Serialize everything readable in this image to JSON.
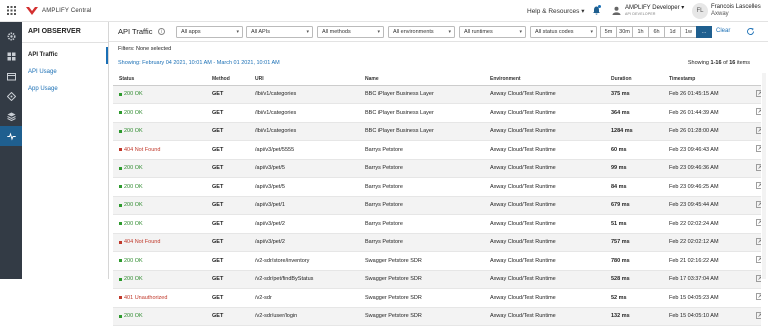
{
  "app": {
    "title": "AMPLIFY Central",
    "help_label": "Help & Resources",
    "user_role_title": "AMPLIFY Developer",
    "user_role_sub": "API DEVELOPER",
    "avatar_initials": "FL",
    "user_name": "Francois Lascelles",
    "user_org": "Axway",
    "brand_color": "#d32f2f",
    "accent_color": "#1f5f8f"
  },
  "left_nav": {
    "icons": [
      "settings-icon",
      "apps-icon",
      "catalog-icon",
      "topology-icon",
      "stack-icon",
      "observer-icon"
    ]
  },
  "sub_nav": {
    "title": "API OBSERVER",
    "items": [
      {
        "label": "API Traffic"
      },
      {
        "label": "API Usage"
      },
      {
        "label": "App Usage"
      }
    ]
  },
  "toolbar": {
    "title": "API Traffic",
    "apps_dropdown": "All apps",
    "apis_dropdown": "All APIs",
    "methods_dropdown": "All methods",
    "environments_dropdown": "All environments",
    "runtimes_dropdown": "All runtimes",
    "status_dropdown": "All status codes",
    "ranges": [
      "5m",
      "30m",
      "1h",
      "6h",
      "1d",
      "1w",
      "..."
    ],
    "clear_label": "Clear"
  },
  "filters_text": "Filters: None selected",
  "showing_range": "Showing: February 04 2021, 10:01 AM - March 01 2021, 10:01 AM",
  "showing_count_prefix": "Showing",
  "showing_count_range": "1-16",
  "showing_count_of": "of",
  "showing_count_total": "16",
  "showing_count_suffix": "items",
  "table": {
    "columns": [
      "Status",
      "Method",
      "URI",
      "Name",
      "Environment",
      "Duration",
      "Timestamp"
    ],
    "rows": [
      {
        "status": "200 OK",
        "ok": true,
        "method": "GET",
        "uri": "/lbi/v1/categories",
        "name": "BBC iPlayer Business Layer",
        "env": "Axway Cloud/Test Runtime",
        "duration": "375 ms",
        "ts": "Feb 26 01:45:15 AM"
      },
      {
        "status": "200 OK",
        "ok": true,
        "method": "GET",
        "uri": "/lbi/v1/categories",
        "name": "BBC iPlayer Business Layer",
        "env": "Axway Cloud/Test Runtime",
        "duration": "364 ms",
        "ts": "Feb 26 01:44:39 AM"
      },
      {
        "status": "200 OK",
        "ok": true,
        "method": "GET",
        "uri": "/lbi/v1/categories",
        "name": "BBC iPlayer Business Layer",
        "env": "Axway Cloud/Test Runtime",
        "duration": "1284 ms",
        "ts": "Feb 26 01:28:00 AM"
      },
      {
        "status": "404 Not Found",
        "ok": false,
        "method": "GET",
        "uri": "/api/v3/pet/5555",
        "name": "Barrys Petstore",
        "env": "Axway Cloud/Test Runtime",
        "duration": "60 ms",
        "ts": "Feb 23 09:46:43 AM"
      },
      {
        "status": "200 OK",
        "ok": true,
        "method": "GET",
        "uri": "/api/v3/pet/5",
        "name": "Barrys Petstore",
        "env": "Axway Cloud/Test Runtime",
        "duration": "99 ms",
        "ts": "Feb 23 09:46:36 AM"
      },
      {
        "status": "200 OK",
        "ok": true,
        "method": "GET",
        "uri": "/api/v3/pet/5",
        "name": "Barrys Petstore",
        "env": "Axway Cloud/Test Runtime",
        "duration": "84 ms",
        "ts": "Feb 23 09:46:25 AM"
      },
      {
        "status": "200 OK",
        "ok": true,
        "method": "GET",
        "uri": "/api/v3/pet/1",
        "name": "Barrys Petstore",
        "env": "Axway Cloud/Test Runtime",
        "duration": "679 ms",
        "ts": "Feb 23 09:45:44 AM"
      },
      {
        "status": "200 OK",
        "ok": true,
        "method": "GET",
        "uri": "/api/v3/pet/2",
        "name": "Barrys Petstore",
        "env": "Axway Cloud/Test Runtime",
        "duration": "51 ms",
        "ts": "Feb 22 02:02:24 AM"
      },
      {
        "status": "404 Not Found",
        "ok": false,
        "method": "GET",
        "uri": "/api/v3/pet/2",
        "name": "Barrys Petstore",
        "env": "Axway Cloud/Test Runtime",
        "duration": "757 ms",
        "ts": "Feb 22 02:02:12 AM"
      },
      {
        "status": "200 OK",
        "ok": true,
        "method": "GET",
        "uri": "/v2-sdr/store/inventory",
        "name": "Swagger Petstore SDR",
        "env": "Axway Cloud/Test Runtime",
        "duration": "780 ms",
        "ts": "Feb 21 02:16:22 AM"
      },
      {
        "status": "200 OK",
        "ok": true,
        "method": "GET",
        "uri": "/v2-sdr/pet/findByStatus",
        "name": "Swagger Petstore SDR",
        "env": "Axway Cloud/Test Runtime",
        "duration": "528 ms",
        "ts": "Feb 17 03:37:04 AM"
      },
      {
        "status": "401 Unauthorized",
        "ok": false,
        "method": "GET",
        "uri": "/v2-sdr",
        "name": "Swagger Petstore SDR",
        "env": "Axway Cloud/Test Runtime",
        "duration": "52 ms",
        "ts": "Feb 15 04:05:23 AM"
      },
      {
        "status": "200 OK",
        "ok": true,
        "method": "GET",
        "uri": "/v2-sdr/user/login",
        "name": "Swagger Petstore SDR",
        "env": "Axway Cloud/Test Runtime",
        "duration": "132 ms",
        "ts": "Feb 15 04:05:10 AM"
      }
    ]
  }
}
